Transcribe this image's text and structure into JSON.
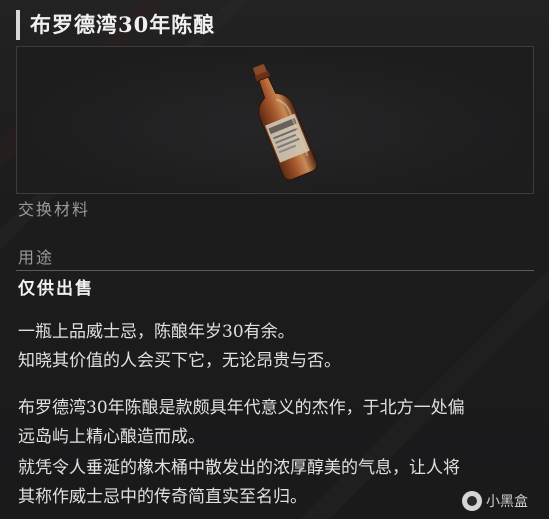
{
  "item": {
    "name": "布罗德湾30年陈酿",
    "category": "交换材料",
    "usage_label": "用途",
    "usage_value": "仅供出售",
    "description": [
      "一瓶上品威士忌，陈酿年岁30有余。",
      "知晓其价值的人会买下它，无论昂贵与否。",
      "布罗德湾30年陈酿是款颇具年代意义的杰作，于北方一处偏",
      "远岛屿上精心酿造而成。",
      "就凭令人垂涎的橡木桶中散发出的浓厚醇美的气息，让人将",
      "其称作威士忌中的传奇简直实至名归。"
    ],
    "image_icon": "whiskey-bottle-icon"
  },
  "watermark": {
    "text": "小黑盒",
    "icon": "heybox-logo-icon"
  },
  "colors": {
    "background": "#1b1b1c",
    "title_text": "#f0f0f0",
    "label_text": "#9a9a9c",
    "body_text": "#e0e0e0",
    "accent_bar": "#d8d8d8",
    "frame_border": "#3c3c3e"
  }
}
